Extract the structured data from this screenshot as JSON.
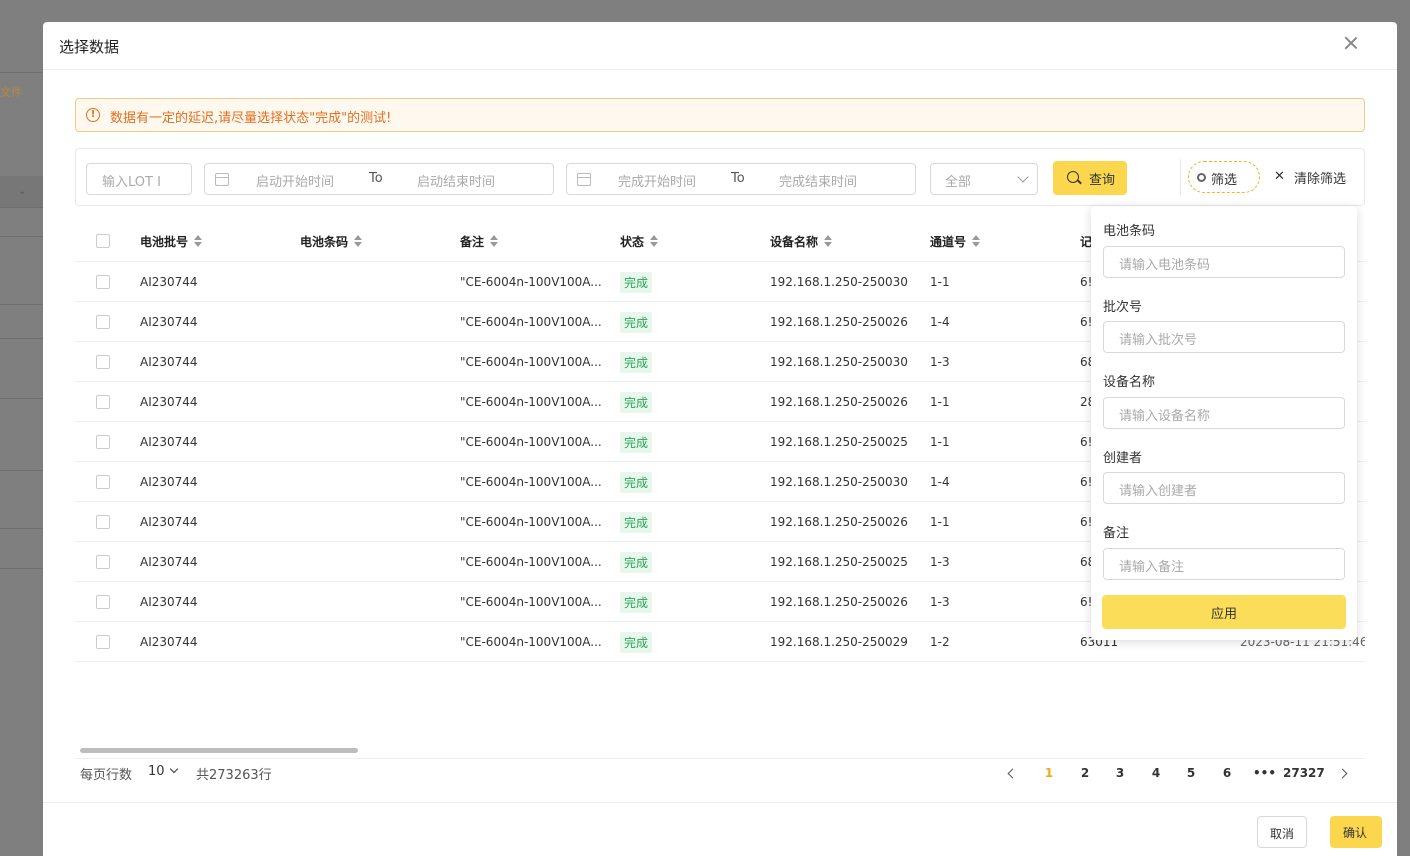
{
  "background": {
    "file_label": "文件"
  },
  "modal": {
    "title": "选择数据"
  },
  "alert": {
    "text": "数据有一定的延迟,请尽量选择状态\"完成\"的测试!"
  },
  "filters": {
    "lot_placeholder": "输入LOT I",
    "start_begin_placeholder": "启动开始时间",
    "start_end_placeholder": "启动结束时间",
    "finish_begin_placeholder": "完成开始时间",
    "finish_end_placeholder": "完成结束时间",
    "to_label": "To",
    "status_select": "全部",
    "query_label": "查询",
    "filter_label": "筛选",
    "clear_label": "清除筛选"
  },
  "table": {
    "columns": [
      "电池批号",
      "电池条码",
      "备注",
      "状态",
      "设备名称",
      "通道号",
      "记"
    ],
    "rows": [
      {
        "batch": "AI230744",
        "note": "\"CE-6004n-100V100A...",
        "status": "完成",
        "device": "192.168.1.250-250030",
        "channel": "1-1",
        "record": "6!"
      },
      {
        "batch": "AI230744",
        "note": "\"CE-6004n-100V100A...",
        "status": "完成",
        "device": "192.168.1.250-250026",
        "channel": "1-4",
        "record": "6!"
      },
      {
        "batch": "AI230744",
        "note": "\"CE-6004n-100V100A...",
        "status": "完成",
        "device": "192.168.1.250-250030",
        "channel": "1-3",
        "record": "68"
      },
      {
        "batch": "AI230744",
        "note": "\"CE-6004n-100V100A...",
        "status": "完成",
        "device": "192.168.1.250-250026",
        "channel": "1-1",
        "record": "28"
      },
      {
        "batch": "AI230744",
        "note": "\"CE-6004n-100V100A...",
        "status": "完成",
        "device": "192.168.1.250-250025",
        "channel": "1-1",
        "record": "6!"
      },
      {
        "batch": "AI230744",
        "note": "\"CE-6004n-100V100A...",
        "status": "完成",
        "device": "192.168.1.250-250030",
        "channel": "1-4",
        "record": "6!"
      },
      {
        "batch": "AI230744",
        "note": "\"CE-6004n-100V100A...",
        "status": "完成",
        "device": "192.168.1.250-250026",
        "channel": "1-1",
        "record": "6!"
      },
      {
        "batch": "AI230744",
        "note": "\"CE-6004n-100V100A...",
        "status": "完成",
        "device": "192.168.1.250-250025",
        "channel": "1-3",
        "record": "68"
      },
      {
        "batch": "AI230744",
        "note": "\"CE-6004n-100V100A...",
        "status": "完成",
        "device": "192.168.1.250-250026",
        "channel": "1-3",
        "record": "6!"
      },
      {
        "batch": "AI230744",
        "note": "\"CE-6004n-100V100A...",
        "status": "完成",
        "device": "192.168.1.250-250029",
        "channel": "1-2",
        "record": "63011",
        "time": "2023-08-11 21:51:46"
      }
    ]
  },
  "pagination": {
    "rows_per_page_label": "每页行数",
    "page_size": "10",
    "total_label": "共273263行",
    "pages": [
      "1",
      "2",
      "3",
      "4",
      "5",
      "6",
      "•••",
      "27327"
    ],
    "current": "1"
  },
  "popover": {
    "fields": [
      {
        "label": "电池条码",
        "placeholder": "请输入电池条码"
      },
      {
        "label": "批次号",
        "placeholder": "请输入批次号"
      },
      {
        "label": "设备名称",
        "placeholder": "请输入设备名称"
      },
      {
        "label": "创建者",
        "placeholder": "请输入创建者"
      },
      {
        "label": "备注",
        "placeholder": "请输入备注"
      }
    ],
    "apply_label": "应用"
  },
  "footer": {
    "cancel_label": "取消",
    "ok_label": "确认"
  },
  "colors": {
    "accent": "#fcd74e",
    "warning": "#e0701e",
    "success": "#2aa456",
    "overlay": "#7f7f7f"
  }
}
